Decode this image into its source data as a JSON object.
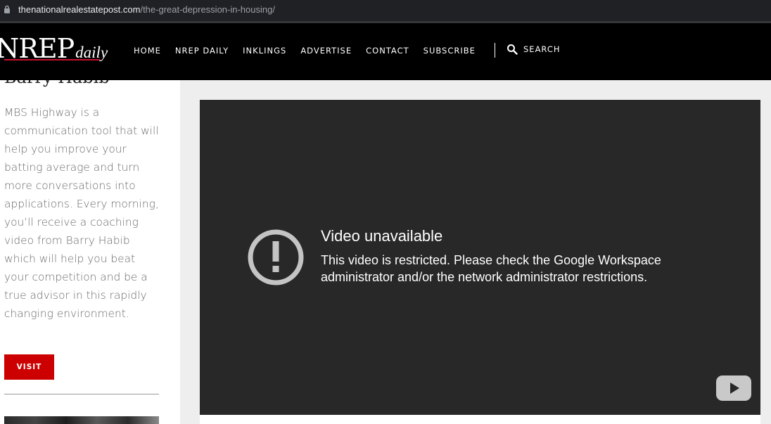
{
  "browser": {
    "url_domain": "thenationalrealestatepost.com",
    "url_path": "/the-great-depression-in-housing/"
  },
  "header": {
    "logo_main": "NREP",
    "logo_sub": "daily",
    "nav": [
      "HOME",
      "NREP DAILY",
      "INKLINGS",
      "ADVERTISE",
      "CONTACT",
      "SUBSCRIBE"
    ],
    "search_label": "SEARCH"
  },
  "sidebar": {
    "author": "Barry Habib",
    "description": "MBS Highway is a communication tool that will help you improve your batting average and turn more conversations into applications. Every morning, you’ll receive a coaching video from Barry Habib which will help you beat your competition and be a true advisor in this rapidly changing environment.",
    "visit_label": "VISIT"
  },
  "video": {
    "title": "Video unavailable",
    "message": "This video is restricted. Please check the Google Workspace administrator and/or the network administrator restrictions."
  },
  "colors": {
    "accent_red": "#cc0000",
    "header_bg": "#000000",
    "video_bg": "#282828"
  },
  "icons": [
    "lock-icon",
    "search-icon",
    "warning-icon",
    "youtube-icon"
  ]
}
